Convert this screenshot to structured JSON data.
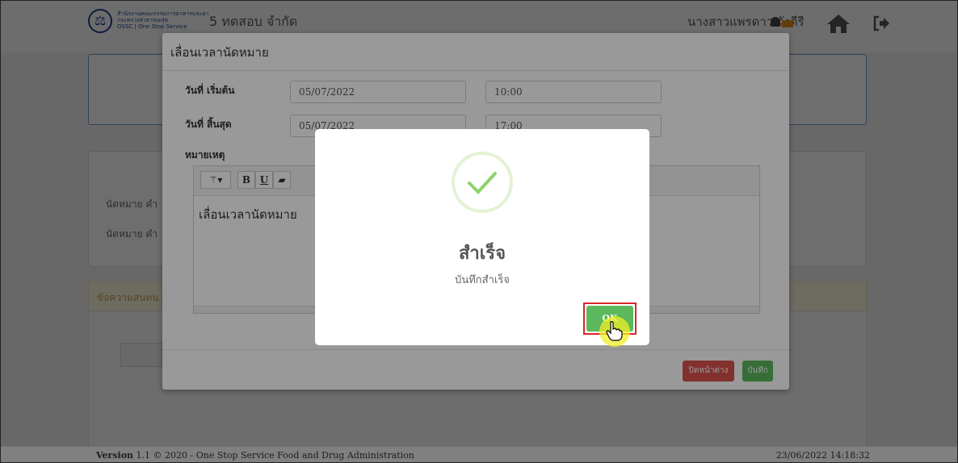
{
  "header": {
    "logo_text": "สำนักงานคณะกรรมการอาหารและยา\nกระทรวงสาธารณสุข\nOSSC | One Stop Service",
    "company": "5 ทดสอบ จำกัด",
    "user_name": "นางสาวแพรดาว วังดีรี"
  },
  "background": {
    "row1": "นัดหมาย คำ",
    "row2": "นัดหมาย คำ",
    "panel_title": "ข้อความสนทน"
  },
  "modal": {
    "title": "เลื่อนเวลานัดหมาย",
    "start_label": "วันที่ เริ่มต้น",
    "start_date": "05/07/2022",
    "start_time": "10:00",
    "end_label": "วันที่ สิ้นสุด",
    "end_date": "05/07/2022",
    "end_time": "17:00",
    "note_label": "หมายเหตุ",
    "toolbar": {
      "bold": "B",
      "underline": "U"
    },
    "note_text": "เลื่อนเวลานัดหมาย",
    "close_label": "ปิดหน้าต่าง",
    "save_label": "บันทึก"
  },
  "dialog": {
    "title": "สำเร็จ",
    "message": "บันทึกสำเร็จ",
    "ok_label": "OK"
  },
  "footer": {
    "version_label": "Version",
    "version_text": " 1.1 © 2020 - One Stop Service Food and Drug Administration",
    "timestamp": "23/06/2022 14:18:32"
  },
  "icons": [
    "government-logo-icon",
    "bell-icon",
    "home-icon",
    "logout-icon",
    "magic-wand-icon",
    "eraser-icon",
    "checkmark-icon",
    "hand-cursor-icon"
  ],
  "colors": {
    "success": "#5cb85c",
    "danger": "#d9534f",
    "highlight": "#d9262c"
  }
}
